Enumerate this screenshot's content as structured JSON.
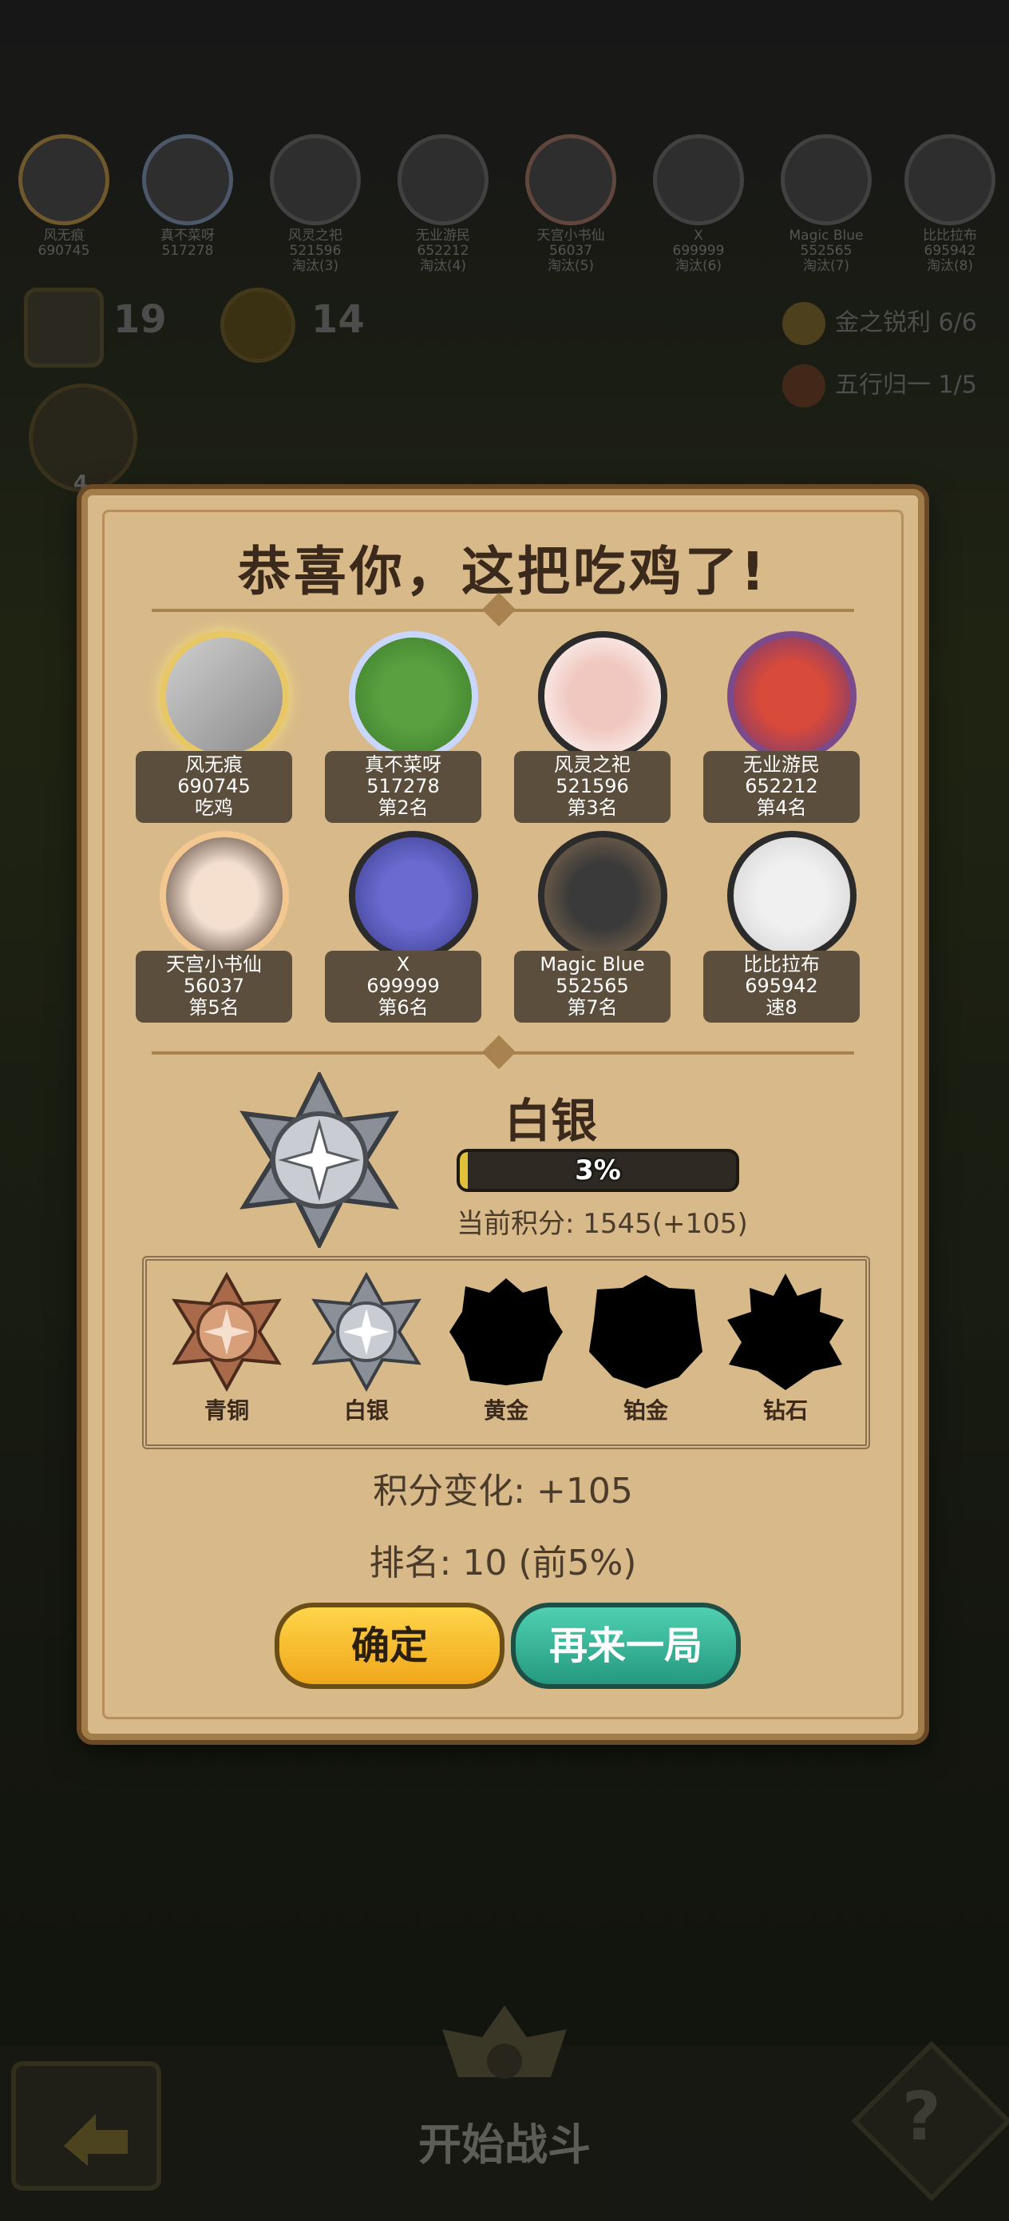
{
  "background": {
    "top_players": [
      {
        "name": "风无痕",
        "score": "690745",
        "status": ""
      },
      {
        "name": "真不菜呀",
        "score": "517278",
        "status": ""
      },
      {
        "name": "风灵之祀",
        "score": "521596",
        "status": "淘汰(3)"
      },
      {
        "name": "无业游民",
        "score": "652212",
        "status": "淘汰(4)"
      },
      {
        "name": "天宫小书仙",
        "score": "56037",
        "status": "淘汰(5)"
      },
      {
        "name": "X",
        "score": "699999",
        "status": "淘汰(6)"
      },
      {
        "name": "Magic Blue",
        "score": "552565",
        "status": "淘汰(7)"
      },
      {
        "name": "比比拉布",
        "score": "695942",
        "status": "淘汰(8)"
      }
    ],
    "timer_value": "19",
    "coin_value": "14",
    "badge_count": "4",
    "buffs": [
      {
        "label": "金之锐利 6/6",
        "color": "#c9a24a"
      },
      {
        "label": "五行归一 1/5",
        "color": "#b06040"
      }
    ],
    "start_button": "开始战斗",
    "help_glyph": "?"
  },
  "modal": {
    "title": "恭喜你，这把吃鸡了!",
    "players": [
      {
        "name": "风无痕",
        "score": "690745",
        "rank": "吃鸡",
        "frame": "gold"
      },
      {
        "name": "真不菜呀",
        "score": "517278",
        "rank": "第2名",
        "frame": "dragon"
      },
      {
        "name": "风灵之祀",
        "score": "521596",
        "rank": "第3名",
        "frame": "plain"
      },
      {
        "name": "无业游民",
        "score": "652212",
        "rank": "第4名",
        "frame": "plain"
      },
      {
        "name": "天宫小书仙",
        "score": "56037",
        "rank": "第5名",
        "frame": "flower"
      },
      {
        "name": "X",
        "score": "699999",
        "rank": "第6名",
        "frame": "plain"
      },
      {
        "name": "Magic Blue",
        "score": "552565",
        "rank": "第7名",
        "frame": "plain"
      },
      {
        "name": "比比拉布",
        "score": "695942",
        "rank": "速8",
        "frame": "plain"
      }
    ],
    "current_rank": "白银",
    "progress_text": "3%",
    "progress_fraction": 0.03,
    "points_text": "当前积分: 1545(+105)",
    "tiers": [
      {
        "label": "青铜",
        "state": "unlocked",
        "color": "#a86a4a"
      },
      {
        "label": "白银",
        "state": "unlocked",
        "color": "#a9adb5"
      },
      {
        "label": "黄金",
        "state": "locked",
        "color": "#000000"
      },
      {
        "label": "铂金",
        "state": "locked",
        "color": "#000000"
      },
      {
        "label": "钻石",
        "state": "locked",
        "color": "#000000"
      }
    ],
    "score_change": "积分变化: +105",
    "rank_line": "排名: 10 (前5%)",
    "confirm_button": "确定",
    "again_button": "再来一局"
  }
}
